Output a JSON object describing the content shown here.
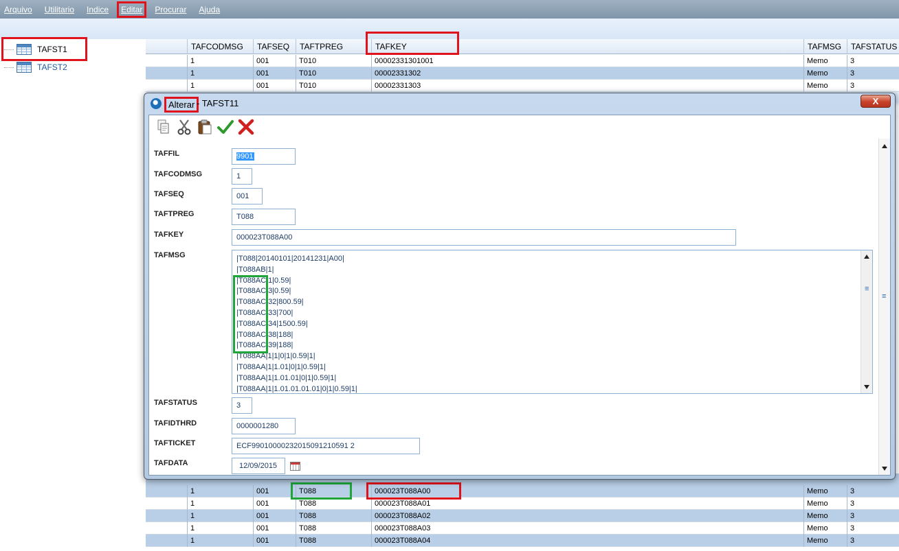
{
  "menu": [
    "Arquivo",
    "Utilitario",
    "Indice",
    "Editar",
    "Procurar",
    "Ajuda"
  ],
  "tree": {
    "items": [
      "TAFST1",
      "TAFST2"
    ]
  },
  "grid": {
    "columns": [
      "TAFCODMSG",
      "TAFSEQ",
      "TAFTPREG",
      "TAFKEY",
      "TAFMSG",
      "TAFSTATUS"
    ],
    "top_rows": [
      [
        "1",
        "001",
        "T010",
        "00002331301001",
        "Memo",
        "3"
      ],
      [
        "1",
        "001",
        "T010",
        "00002331302",
        "Memo",
        "3"
      ],
      [
        "1",
        "001",
        "T010",
        "00002331303",
        "Memo",
        "3"
      ]
    ],
    "bottom_rows": [
      [
        "1",
        "001",
        "T088",
        "000023T088A00",
        "Memo",
        "3"
      ],
      [
        "1",
        "001",
        "T088",
        "000023T088A01",
        "Memo",
        "3"
      ],
      [
        "1",
        "001",
        "T088",
        "000023T088A02",
        "Memo",
        "3"
      ],
      [
        "1",
        "001",
        "T088",
        "000023T088A03",
        "Memo",
        "3"
      ],
      [
        "1",
        "001",
        "T088",
        "000023T088A04",
        "Memo",
        "3"
      ]
    ]
  },
  "dialog": {
    "operation": "Alterar",
    "title_rest": " - TAFST11",
    "close_label": "X",
    "labels": {
      "taffil": "TAFFIL",
      "tafcodmsg": "TAFCODMSG",
      "tafseq": "TAFSEQ",
      "taftpreg": "TAFTPREG",
      "tafkey": "TAFKEY",
      "tafmsg": "TAFMSG",
      "tafstatus": "TAFSTATUS",
      "tafidthrd": "TAFIDTHRD",
      "tafticket": "TAFTICKET",
      "tafdata": "TAFDATA"
    },
    "values": {
      "taffil": "9901",
      "tafcodmsg": "1",
      "tafseq": "001",
      "taftpreg": "T088",
      "tafkey": "000023T088A00",
      "tafstatus": "3",
      "tafidthrd": "0000001280",
      "tafticket": "ECF99010000232015091210591 2",
      "tafdata": "12/09/2015"
    },
    "memo_lines": [
      "|T088|20140101|20141231|A00|",
      "|T088AB|1|",
      "|T088AC|1|0.59|",
      "|T088AC|3|0.59|",
      "|T088AC|32|800.59|",
      "|T088AC|33|700|",
      "|T088AC|34|1500.59|",
      "|T088AC|38|188|",
      "|T088AC|39|188|",
      "|T088AA|1|1|0|1|0.59|1|",
      "|T088AA|1|1.01|0|1|0.59|1|",
      "|T088AA|1|1.01.01|0|1|0.59|1|",
      "|T088AA|1|1.01.01.01.01|0|1|0.59|1|"
    ],
    "toolbar": [
      "copy-icon",
      "cut-icon",
      "paste-icon",
      "confirm-icon",
      "cancel-icon"
    ]
  }
}
